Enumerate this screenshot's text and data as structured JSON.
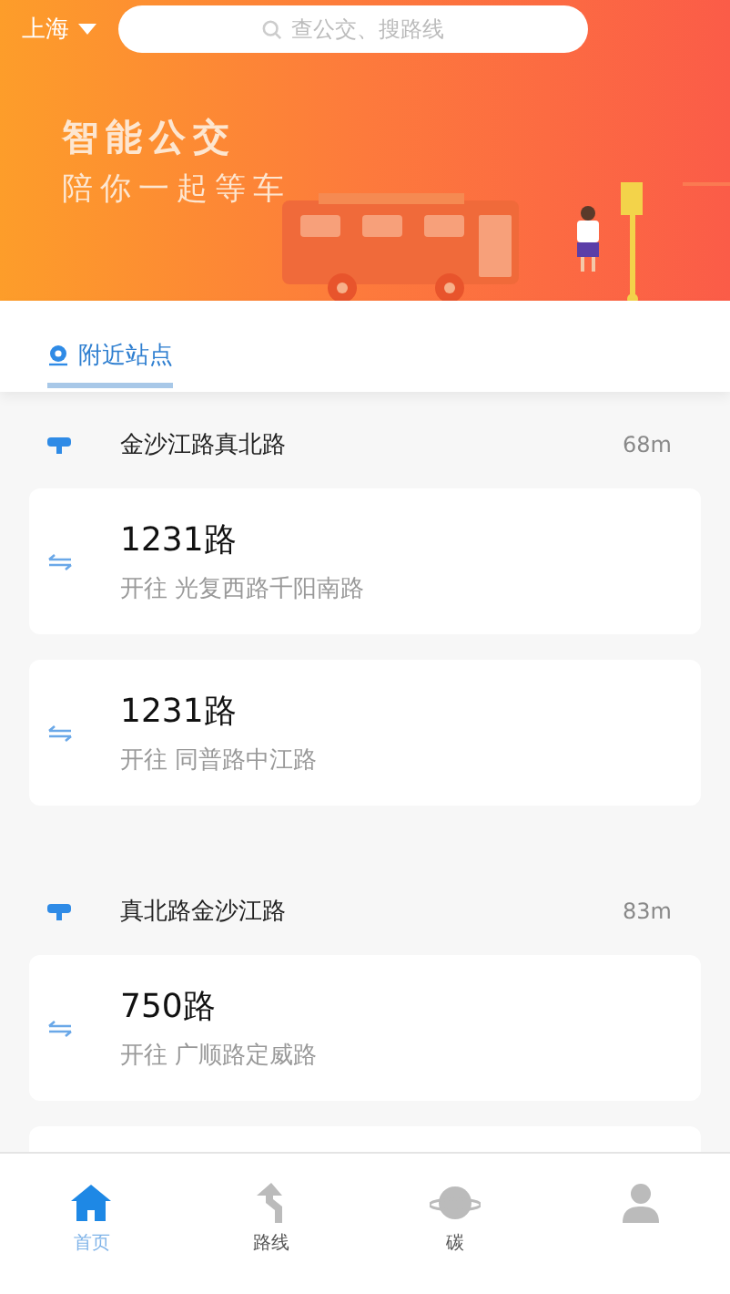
{
  "header": {
    "city": "上海",
    "search": {
      "placeholder": "查公交、搜路线"
    },
    "banner": {
      "title": "智能公交",
      "subtitle": "陪你一起等车"
    }
  },
  "tabs": [
    {
      "label": "附近站点",
      "selected": true
    }
  ],
  "stops": [
    {
      "name": "金沙江路真北路",
      "distance": "68m",
      "lines": [
        {
          "line": "1231路",
          "direction": "开往 光复西路千阳南路"
        },
        {
          "line": "1231路",
          "direction": "开往 同普路中江路"
        }
      ]
    },
    {
      "name": "真北路金沙江路",
      "distance": "83m",
      "lines": [
        {
          "line": "750路",
          "direction": "开往 广顺路定威路"
        }
      ]
    }
  ],
  "nav": [
    {
      "label": "首页",
      "selected": true
    },
    {
      "label": "路线",
      "selected": false
    },
    {
      "label": "碳",
      "selected": false
    },
    {
      "selected": false
    }
  ]
}
